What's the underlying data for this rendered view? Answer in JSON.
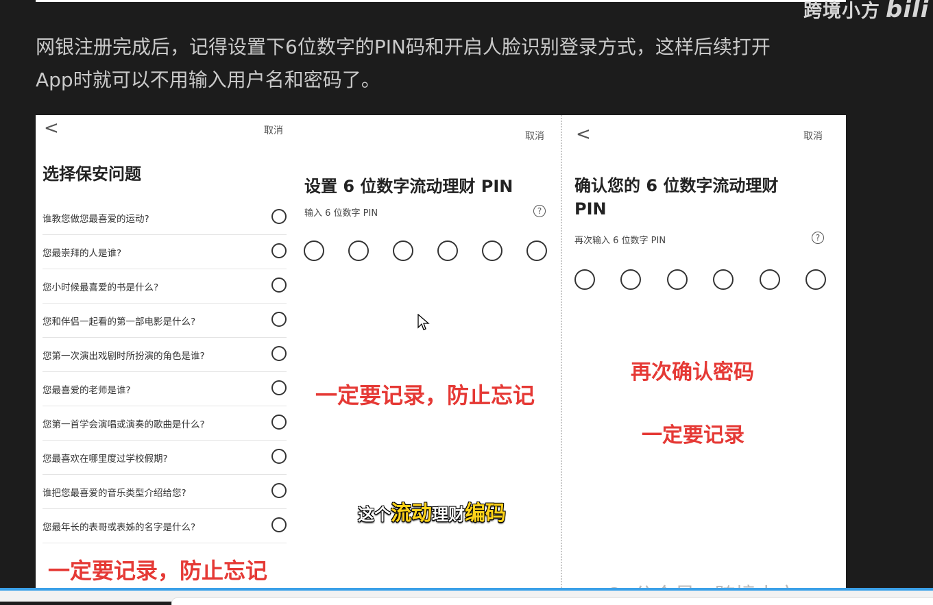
{
  "watermark": {
    "text": "跨境小方",
    "logo": "bili"
  },
  "paragraph": {
    "line1": "网银注册完成后，记得设置下6位数字的PIN码和开启人脸识别登录方式，这样后续打开",
    "line2": "App时就可以不用输入用户名和密码了。"
  },
  "screen1": {
    "back": "<",
    "cancel": "取消",
    "title": "选择保安问题",
    "questions": [
      "谁教您做您最喜爱的运动?",
      "您最崇拜的人是谁?",
      "您小时候最喜爱的书是什么?",
      "您和伴侣一起看的第一部电影是什么?",
      "您第一次演出戏剧时所扮演的角色是谁?",
      "您最喜爱的老师是谁?",
      "您第一首学会演唱或演奏的歌曲是什么?",
      "您最喜欢在哪里度过学校假期?",
      "谁把您最喜爱的音乐类型介绍给您?",
      "您最年长的表哥或表姊的名字是什么?"
    ],
    "annotation": "一定要记录，防止忘记"
  },
  "screen2": {
    "cancel": "取消",
    "title": "设置 6 位数字流动理财 PIN",
    "input_label": "输入 6 位数字 PIN",
    "help": "?",
    "annotation": "一定要记录，防止忘记"
  },
  "screen3": {
    "back": "<",
    "cancel": "取消",
    "title_line1": "确认您的 6 位数字流动理财",
    "title_line2": "PIN",
    "input_label": "再次输入 6 位数字 PIN",
    "help": "?",
    "annotation1": "再次确认密码",
    "annotation2": "一定要记录"
  },
  "caption": {
    "part1": "这个",
    "part2": "流动",
    "part3": "理财",
    "part4": "编码"
  },
  "bottom_watermark": "公众号 · 跨境小方",
  "colors": {
    "annotation_red": "#e53935",
    "caption_yellow": "#ffd21a",
    "accent_blue": "#3aa0e8"
  }
}
